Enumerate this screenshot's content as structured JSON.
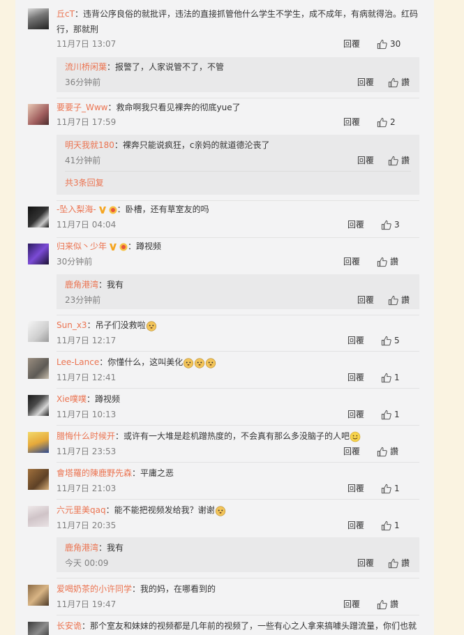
{
  "labels": {
    "reply": "回覆",
    "like_empty": "讚",
    "more_replies": "共3条回复"
  },
  "comments": [
    {
      "name": "丘cT",
      "text": "：违背公序良俗的就批评，违法的直接抓管他什么学生不学生，成不成年，有病就得治。红码行，那就刑",
      "time": "11月7日 13:07",
      "likes": "30"
    },
    {
      "name": "要要子_Www",
      "text": "：救命啊我只看见裸奔的彻底yue了",
      "time": "11月7日 17:59",
      "likes": "2"
    },
    {
      "name": "-坠入梨海-",
      "text": "：卧槽，还有草室友的吗",
      "time": "11月7日 04:04",
      "likes": "3"
    },
    {
      "name": "归来似丶少年",
      "text": "：蹲视频",
      "time": "30分钟前",
      "likes": "讚"
    },
    {
      "name": "Sun_x3",
      "text": "：吊子们没救啦",
      "time": "11月7日 12:17",
      "likes": "5"
    },
    {
      "name": "Lee-Lance",
      "text": "：你懂什么，这叫美化",
      "time": "11月7日 12:41",
      "likes": "1"
    },
    {
      "name": "Xie噗噗",
      "text": "：蹲视频",
      "time": "11月7日 10:13",
      "likes": "1"
    },
    {
      "name": "腊悔什么时候开",
      "text": "：或许有一大堆是趁机蹭热度的，不会真有那么多没脑子的人吧",
      "time": "11月7日 23:53",
      "likes": "讚"
    },
    {
      "name": "會塔羅的陳鹿野先森",
      "text": "：平庸之恶",
      "time": "11月7日 21:03",
      "likes": "1"
    },
    {
      "name": "六元里美qaq",
      "text": "：能不能把视频发给我？谢谢",
      "time": "11月7日 20:35",
      "likes": "1"
    },
    {
      "name": "爱喝奶茶的小许同学",
      "text": "：我的妈，在哪看到的",
      "time": "11月7日 19:47",
      "likes": "讚"
    },
    {
      "name": "长安诡",
      "text": "：那个室友和妹妹的视频都是几年前的视频了，一些有心之人拿来搞噱头蹭流量，你们也就"
    }
  ],
  "subs": [
    {
      "name": "流川桥闲葉",
      "text": "：报警了，人家说管不了，不管",
      "time": "36分钟前",
      "likes": "讚"
    },
    {
      "name": "明天我就180",
      "text": "：裸奔只能说疯狂，c亲妈的就道德沦丧了",
      "time": "41分钟前",
      "likes": "讚"
    },
    {
      "name": "鹿角港湾",
      "text": "：我有",
      "time": "23分钟前",
      "likes": "讚"
    },
    {
      "name": "鹿角港湾",
      "text": "：我有",
      "time": "今天 00:09",
      "likes": "讚"
    }
  ],
  "colors": {
    "name": "#eb7350",
    "time": "#808080",
    "panel": "#f3f3f4",
    "sub": "#e9e9ea",
    "page": "#faf3e1"
  }
}
